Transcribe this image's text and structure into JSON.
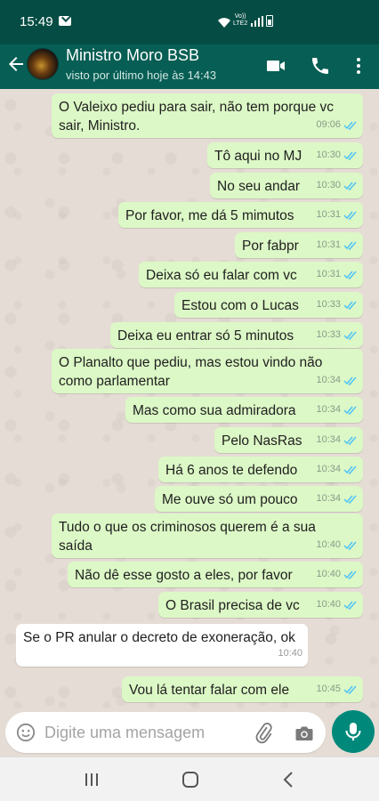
{
  "status_bar": {
    "time": "15:49",
    "volte_line1": "Vo))",
    "volte_line2": "LTE2"
  },
  "header": {
    "contact_name": "Ministro Moro BSB",
    "last_seen": "visto por último hoje às 14:43",
    "icons": [
      "back-arrow-icon",
      "video-call-icon",
      "phone-icon",
      "more-options-icon"
    ]
  },
  "messages": [
    {
      "direction": "out",
      "lines": [
        "O Valeixo pediu para sair, não tem porque vc",
        "sair, Ministro."
      ],
      "time": "09:06",
      "read": true
    },
    {
      "direction": "out",
      "lines": [
        "Tô aqui no MJ"
      ],
      "time": "10:30",
      "read": true
    },
    {
      "direction": "out",
      "lines": [
        "No seu andar"
      ],
      "time": "10:30",
      "read": true
    },
    {
      "direction": "out",
      "lines": [
        "Por favor, me dá 5 mimutos"
      ],
      "time": "10:31",
      "read": true
    },
    {
      "direction": "out",
      "lines": [
        "Por fabpr"
      ],
      "time": "10:31",
      "read": true
    },
    {
      "direction": "out",
      "lines": [
        "Deixa só eu falar com vc"
      ],
      "time": "10:31",
      "read": true
    },
    {
      "direction": "out",
      "lines": [
        "Estou com o Lucas"
      ],
      "time": "10:33",
      "read": true
    },
    {
      "direction": "out",
      "lines": [
        "Deixa eu entrar só 5 minutos"
      ],
      "time": "10:33",
      "read": true
    },
    {
      "direction": "out",
      "lines": [
        "O Planalto que pediu, mas estou vindo não",
        "como parlamentar"
      ],
      "time": "10:34",
      "read": true
    },
    {
      "direction": "out",
      "lines": [
        "Mas como sua admiradora"
      ],
      "time": "10:34",
      "read": true
    },
    {
      "direction": "out",
      "lines": [
        "Pelo NasRas"
      ],
      "time": "10:34",
      "read": true
    },
    {
      "direction": "out",
      "lines": [
        "Há 6 anos te defendo"
      ],
      "time": "10:34",
      "read": true
    },
    {
      "direction": "out",
      "lines": [
        "Me ouve só um pouco"
      ],
      "time": "10:34",
      "read": true
    },
    {
      "direction": "out",
      "lines": [
        "Tudo o que os criminosos querem é a sua",
        "saída"
      ],
      "time": "10:40",
      "read": true
    },
    {
      "direction": "out",
      "lines": [
        "Não dê esse gosto a eles,  por favor"
      ],
      "time": "10:40",
      "read": true
    },
    {
      "direction": "out",
      "lines": [
        "O Brasil precisa de vc"
      ],
      "time": "10:40",
      "read": true
    },
    {
      "direction": "in",
      "lines": [
        "Se o PR anular o decreto de exoneração, ok"
      ],
      "time": "10:40",
      "read": false
    },
    {
      "direction": "out",
      "lines": [
        "Vou lá tentar falar com ele"
      ],
      "time": "10:45",
      "read": true
    }
  ],
  "composer": {
    "placeholder": "Digite uma mensagem",
    "icons": [
      "emoji-icon",
      "attach-icon",
      "camera-icon",
      "mic-icon"
    ]
  },
  "colors": {
    "header": "#075e54",
    "status_bar": "#054d44",
    "outgoing_bubble": "#dcf8c6",
    "incoming_bubble": "#ffffff",
    "read_ticks": "#4fc3f7",
    "mic_button": "#00897b",
    "chat_background": "#e5ddd5"
  }
}
